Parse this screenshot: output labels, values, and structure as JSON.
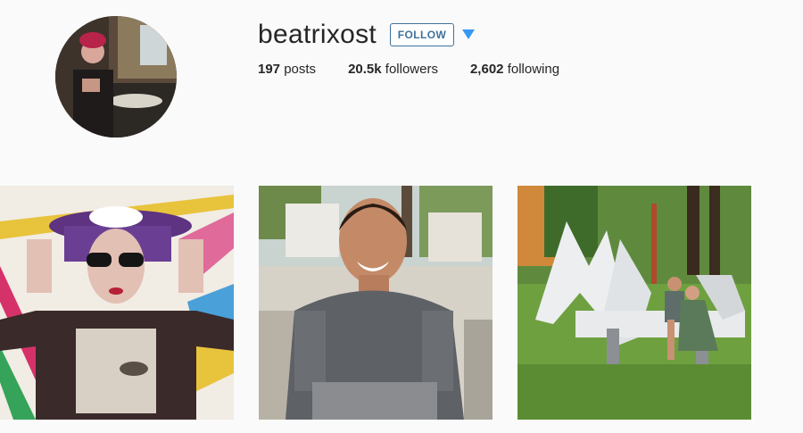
{
  "profile": {
    "username": "beatrixost",
    "follow_label": "FOLLOW",
    "avatar_icon": "profile-avatar",
    "dropdown_icon": "triangle-down-icon"
  },
  "stats": [
    {
      "count": "197",
      "label": "posts"
    },
    {
      "count": "20.5k",
      "label": "followers"
    },
    {
      "count": "2,602",
      "label": "following"
    }
  ],
  "colors": {
    "accent": "#3f729b",
    "dropdown": "#3897f0",
    "background": "#fafafa"
  }
}
